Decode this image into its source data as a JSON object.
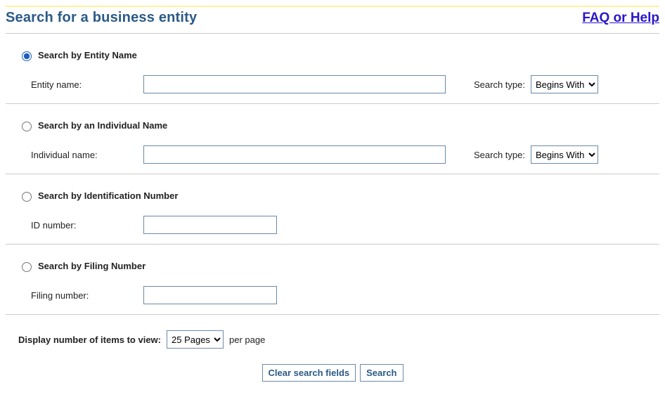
{
  "header": {
    "title": "Search for a business entity",
    "help_link": "FAQ or Help"
  },
  "sections": {
    "entity": {
      "radio_label": "Search by Entity Name",
      "field_label": "Entity name:",
      "search_type_label": "Search type:",
      "search_type_value": "Begins With"
    },
    "individual": {
      "radio_label": "Search by an Individual Name",
      "field_label": "Individual name:",
      "search_type_label": "Search type:",
      "search_type_value": "Begins With"
    },
    "idnum": {
      "radio_label": "Search by Identification Number",
      "field_label": "ID number:"
    },
    "filing": {
      "radio_label": "Search by Filing Number",
      "field_label": "Filing number:"
    }
  },
  "display": {
    "label": "Display number of items to view:",
    "value": "25 Pages",
    "suffix": "per page"
  },
  "buttons": {
    "clear": "Clear search fields",
    "search": "Search"
  }
}
